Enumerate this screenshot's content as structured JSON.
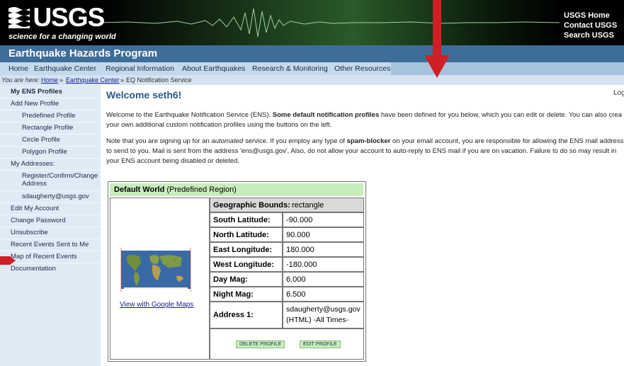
{
  "header": {
    "logo_text": "USGS",
    "tagline": "science for a changing world",
    "links": [
      "USGS Home",
      "Contact USGS",
      "Search USGS"
    ]
  },
  "program_title": "Earthquake Hazards Program",
  "top_nav": [
    "Home",
    "Earthquake Center",
    "Regional Information",
    "About Earthquakes",
    "Research & Monitoring",
    "Other Resources"
  ],
  "breadcrumb": {
    "prefix": "You are here:",
    "home": "Home",
    "sep1": "»",
    "center": "Earthquake Center",
    "sep2": "»",
    "current": "EQ Notification Service"
  },
  "sidebar": {
    "my_profiles": "My ENS Profiles",
    "add_new": "Add New Profile",
    "predefined": "Predefined Profile",
    "rectangle": "Rectangle Profile",
    "circle": "Circle Profile",
    "polygon": "Polygon Profile",
    "addresses": "My Addresses:",
    "register_1": "Register/Confirm/Change",
    "register_2": "Address",
    "email": "sdaugherty@usgs.gov",
    "edit_account": "Edit My Account",
    "change_password": "Change Password",
    "unsubscribe": "Unsubscribe",
    "recent_sent": "Recent Events Sent to Me",
    "map_recent": "Map of Recent Events",
    "documentation": "Documentation"
  },
  "main": {
    "welcome": "Welcome seth6!",
    "logout": "Log",
    "p1_a": "Welcome to the Earthquake Notification Service (ENS). ",
    "p1_b": "Some default notification profiles",
    "p1_c": " have been defined for you below, which you can edit or delete. You can also crea",
    "p1_line2": "your own additional custom notification profiles using the buttons on the left.",
    "p2_a": "Note that you are signing up for an ",
    "p2_b": "automated",
    "p2_c": " service. If you employ any type of ",
    "p2_d": "spam-blocker",
    "p2_e": " on your email account, you are responsible for allowing the ENS mail address",
    "p2_line2": "to send to you. Mail is sent from the address 'ens@usgs.gov'. Also, do not allow your account to auto-reply to ENS mail if you are on vacation. Failure to do so may result in",
    "p2_line3": "your ENS account being disabled or deleted."
  },
  "profile": {
    "name": "Default World",
    "type": "(Predefined Region)",
    "bounds_label": "Geographic Bounds:",
    "bounds_value": "rectangle",
    "rows": [
      {
        "label": "South Latitude:",
        "value": "-90.000"
      },
      {
        "label": "North Latitude:",
        "value": "90.000"
      },
      {
        "label": "East Longitude:",
        "value": "180.000"
      },
      {
        "label": "West Longitude:",
        "value": "-180.000"
      },
      {
        "label": "Day Mag:",
        "value": "6.000"
      },
      {
        "label": "Night Mag:",
        "value": "6.500"
      }
    ],
    "address_label": "Address 1:",
    "address_line1": "sdaugherty@usgs.gov",
    "address_line2": "(HTML) -All Times-",
    "map_link": "View with Google Maps",
    "delete_button": "DELETE PROFILE",
    "edit_button": "EDIT PROFILE"
  },
  "colors": {
    "banner": "#000000",
    "program_bar": "#3f6d99",
    "sidebar": "#dfeaf5",
    "green_header": "#c9ecbd",
    "arrow": "#d01f25"
  }
}
